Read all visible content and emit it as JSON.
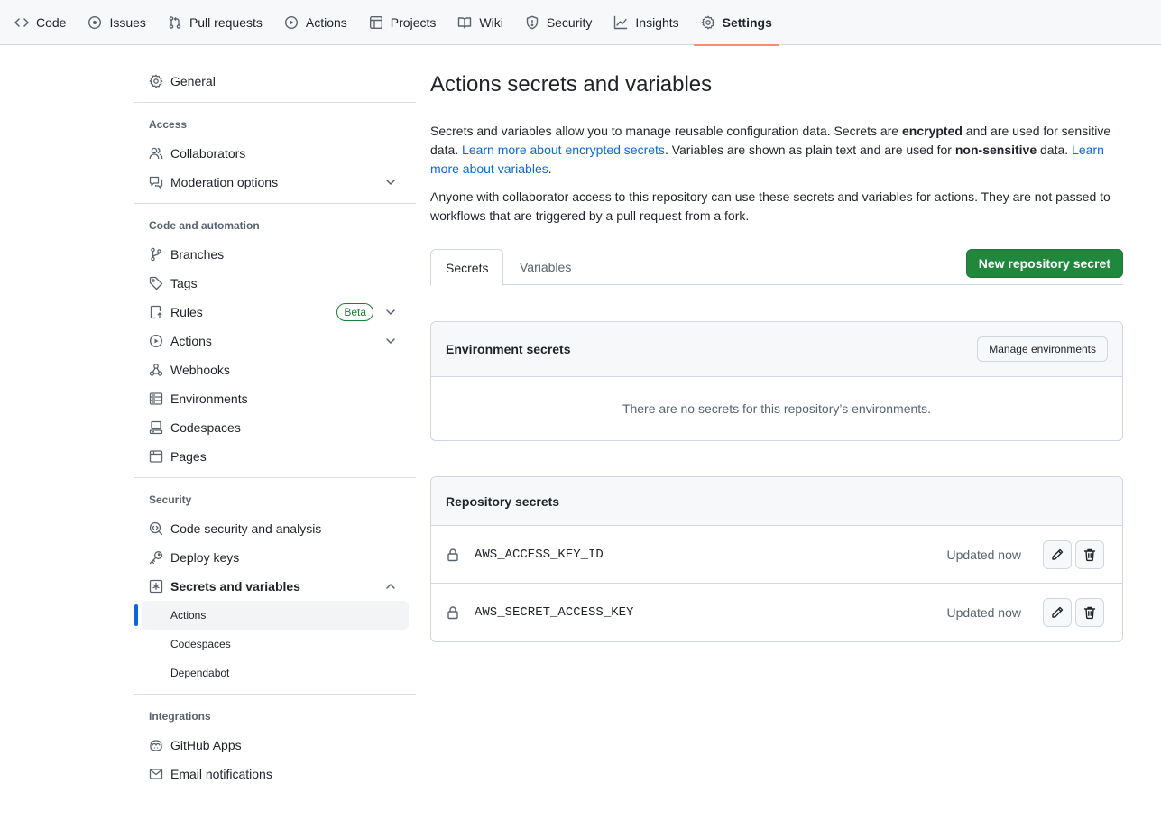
{
  "repo_nav": {
    "tabs": [
      {
        "label": "Code",
        "icon": "code-icon"
      },
      {
        "label": "Issues",
        "icon": "issue-opened-icon"
      },
      {
        "label": "Pull requests",
        "icon": "git-pull-request-icon"
      },
      {
        "label": "Actions",
        "icon": "play-icon"
      },
      {
        "label": "Projects",
        "icon": "table-icon"
      },
      {
        "label": "Wiki",
        "icon": "book-icon"
      },
      {
        "label": "Security",
        "icon": "shield-icon"
      },
      {
        "label": "Insights",
        "icon": "graph-icon"
      },
      {
        "label": "Settings",
        "icon": "gear-icon",
        "active": true
      }
    ]
  },
  "sidebar": {
    "general": "General",
    "access": {
      "heading": "Access",
      "collaborators": "Collaborators",
      "moderation": "Moderation options"
    },
    "code_automation": {
      "heading": "Code and automation",
      "branches": "Branches",
      "tags": "Tags",
      "rules": "Rules",
      "rules_badge": "Beta",
      "actions": "Actions",
      "webhooks": "Webhooks",
      "environments": "Environments",
      "codespaces": "Codespaces",
      "pages": "Pages"
    },
    "security": {
      "heading": "Security",
      "code_security": "Code security and analysis",
      "deploy_keys": "Deploy keys",
      "secrets_variables": "Secrets and variables",
      "sub_actions": "Actions",
      "sub_codespaces": "Codespaces",
      "sub_dependabot": "Dependabot"
    },
    "integrations": {
      "heading": "Integrations",
      "github_apps": "GitHub Apps",
      "email_notifications": "Email notifications"
    }
  },
  "main": {
    "title": "Actions secrets and variables",
    "desc1": {
      "part1": "Secrets and variables allow you to manage reusable configuration data. Secrets are ",
      "bold1": "encrypted",
      "part2": " and are used for sensitive data. ",
      "link1": "Learn more about encrypted secrets",
      "part3": ". Variables are shown as plain text and are used for ",
      "bold2": "non-sensitive",
      "part4": " data. ",
      "link2": "Learn more about variables",
      "part5": "."
    },
    "desc2": "Anyone with collaborator access to this repository can use these secrets and variables for actions. They are not passed to workflows that are triggered by a pull request from a fork.",
    "tabs": {
      "secrets": "Secrets",
      "variables": "Variables"
    },
    "new_secret_button": "New repository secret",
    "env_secrets": {
      "heading": "Environment secrets",
      "manage_button": "Manage environments",
      "empty": "There are no secrets for this repository’s environments."
    },
    "repo_secrets": {
      "heading": "Repository secrets",
      "rows": [
        {
          "name": "AWS_ACCESS_KEY_ID",
          "updated": "Updated now"
        },
        {
          "name": "AWS_SECRET_ACCESS_KEY",
          "updated": "Updated now"
        }
      ]
    }
  },
  "colors": {
    "accent": "#0969da",
    "primary_button": "#1f883d",
    "tab_underline": "#fd8c73",
    "beta_badge": "#1a7f37"
  }
}
